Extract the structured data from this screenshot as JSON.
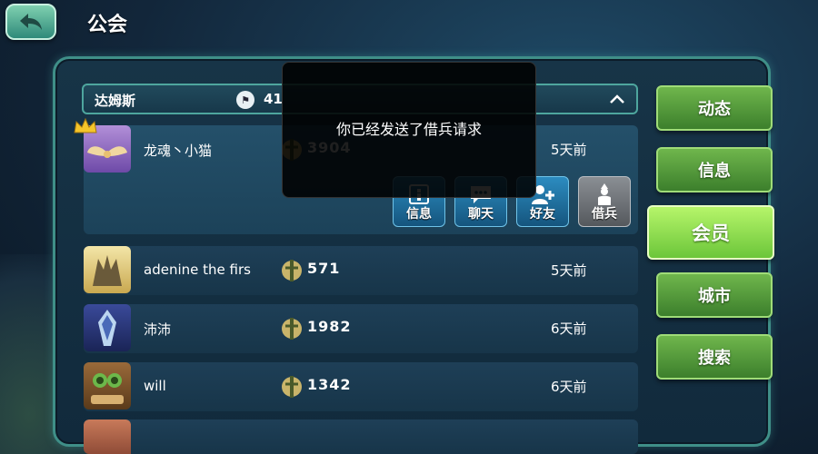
{
  "header": {
    "title": "公会",
    "back_icon": "back-arrow-icon"
  },
  "guild": {
    "name": "达姆斯",
    "member_count": "41",
    "flag_icon": "flag-icon",
    "collapse_icon": "chevron-up-icon"
  },
  "members": [
    {
      "name": "龙魂丶小猫",
      "power": "3904",
      "last_seen": "5天前",
      "is_leader": true
    },
    {
      "name": "adenine the firs",
      "power": "571",
      "last_seen": "5天前"
    },
    {
      "name": "沛沛",
      "power": "1982",
      "last_seen": "6天前"
    },
    {
      "name": "will",
      "power": "1342",
      "last_seen": "6天前"
    }
  ],
  "actions": {
    "info": "信息",
    "chat": "聊天",
    "friend": "好友",
    "borrow": "借兵"
  },
  "toast": {
    "message": "你已经发送了借兵请求"
  },
  "tabs": [
    {
      "label": "动态",
      "active": false
    },
    {
      "label": "信息",
      "active": false
    },
    {
      "label": "会员",
      "active": true
    },
    {
      "label": "城市",
      "active": false
    },
    {
      "label": "搜索",
      "active": false
    }
  ],
  "colors": {
    "tab_green": "#4c9a34",
    "tab_active": "#8ee04c",
    "frame_teal": "#3f8f88",
    "action_blue": "#2c8cc0",
    "action_grey": "#7a7f84"
  }
}
